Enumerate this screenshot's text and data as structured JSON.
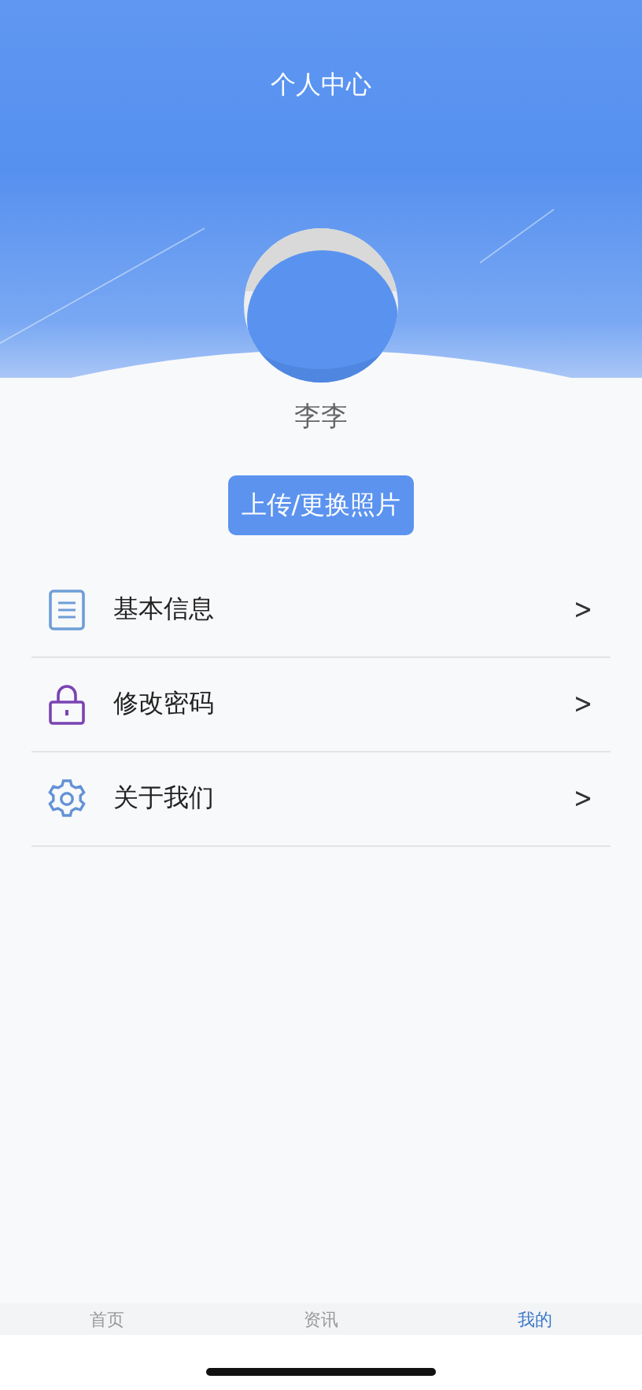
{
  "header": {
    "title": "个人中心"
  },
  "profile": {
    "name": "李李",
    "upload_button": "上传/更换照片"
  },
  "menu": [
    {
      "kind": "document",
      "label": "基本信息",
      "chevron": ">"
    },
    {
      "kind": "lock",
      "label": "修改密码",
      "chevron": ">"
    },
    {
      "kind": "gear",
      "label": "关于我们",
      "chevron": ">"
    }
  ],
  "tab_bar": [
    {
      "label": "首页",
      "selected": false
    },
    {
      "label": "资讯",
      "selected": false
    },
    {
      "label": "我的",
      "selected": true
    }
  ]
}
